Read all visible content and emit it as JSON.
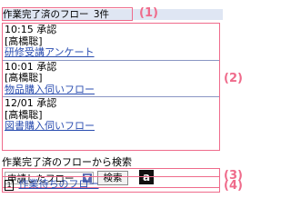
{
  "header": {
    "title": "作業完了済のフロー",
    "count": "3件"
  },
  "callouts": [
    "(1)",
    "(2)",
    "(3)",
    "(4)"
  ],
  "items": [
    {
      "time": "10:15 承認",
      "name": "[高橋聡]",
      "link": "研修受講アンケート"
    },
    {
      "time": "10:01 承認",
      "name": "[高橋聡]",
      "link": "物品購入伺いフロー"
    },
    {
      "time": "12/01 承認",
      "name": "[高橋聡]",
      "link": "図書購入伺いフロー"
    }
  ],
  "search": {
    "title": "作業完了済のフローから検索",
    "select": "申請したフロー",
    "button": "検索",
    "logo": "a"
  },
  "waiting": {
    "num": "1",
    "link": "作業待ちのフロー"
  }
}
